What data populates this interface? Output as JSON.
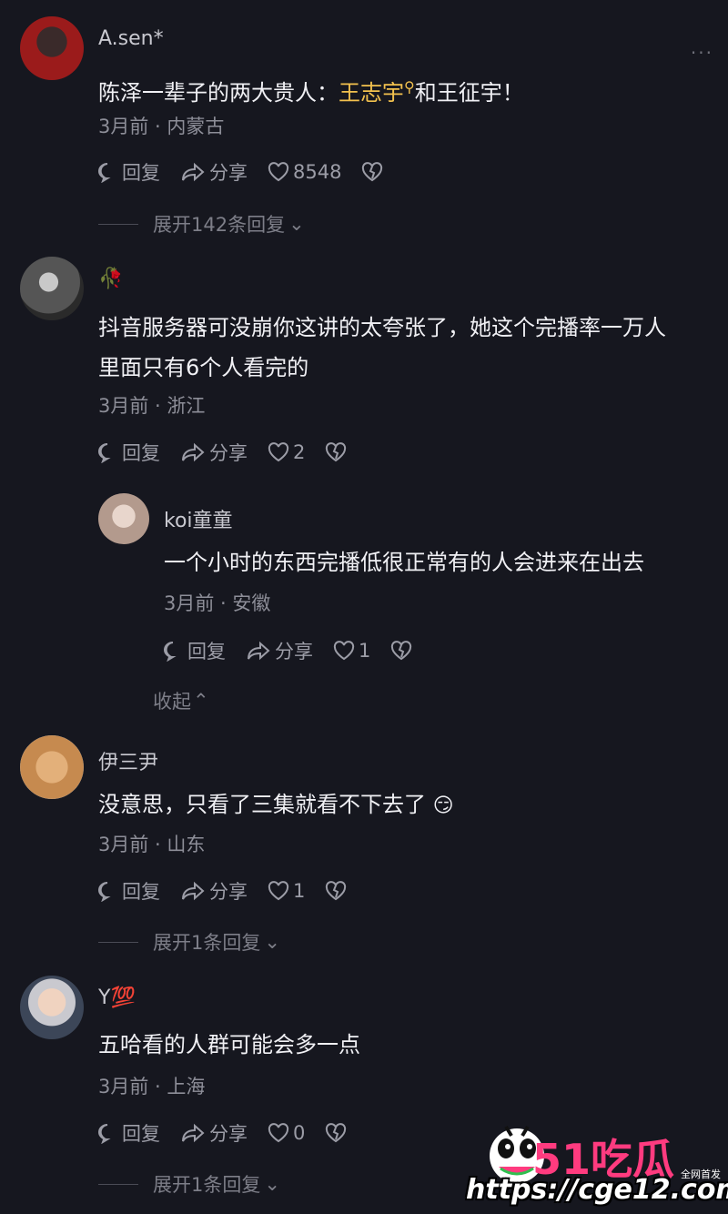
{
  "comments": [
    {
      "username": "A.sen*",
      "text_before": "陈泽一辈子的两大贵人：",
      "text_highlight": "王志宇",
      "text_after": "和王征宇！",
      "meta": "3月前 · 内蒙古",
      "reply_label": "回复",
      "share_label": "分享",
      "likes": "8548",
      "expand_label": "展开142条回复"
    },
    {
      "username": "",
      "text_line1": "抖音服务器可没崩你这讲的太夸张了，她这个完播率一万人",
      "text_line2": "里面只有6个人看完的",
      "meta": "3月前 · 浙江",
      "reply_label": "回复",
      "share_label": "分享",
      "likes": "2"
    },
    {
      "username": "koi童童",
      "text": "一个小时的东西完播低很正常有的人会进来在出去",
      "meta": "3月前 · 安徽",
      "reply_label": "回复",
      "share_label": "分享",
      "likes": "1",
      "collapse_label": "收起"
    },
    {
      "username": "伊三尹",
      "text": "没意思，只看了三集就看不下去了",
      "emoji": "😏",
      "meta": "3月前 · 山东",
      "reply_label": "回复",
      "share_label": "分享",
      "likes": "1",
      "expand_label": "展开1条回复"
    },
    {
      "username": "Y💯",
      "text": "五哈看的人群可能会多一点",
      "meta": "3月前 · 上海",
      "reply_label": "回复",
      "share_label": "分享",
      "likes": "0",
      "expand_label": "展开1条回复"
    }
  ],
  "more_menu": "···",
  "watermark": {
    "brand": "51吃瓜",
    "tag": "全网首发",
    "url": "https://cge12.com"
  },
  "colors": {
    "background": "#16171f",
    "highlight": "#f2c14e",
    "watermark_pink": "#ff3b7f"
  }
}
